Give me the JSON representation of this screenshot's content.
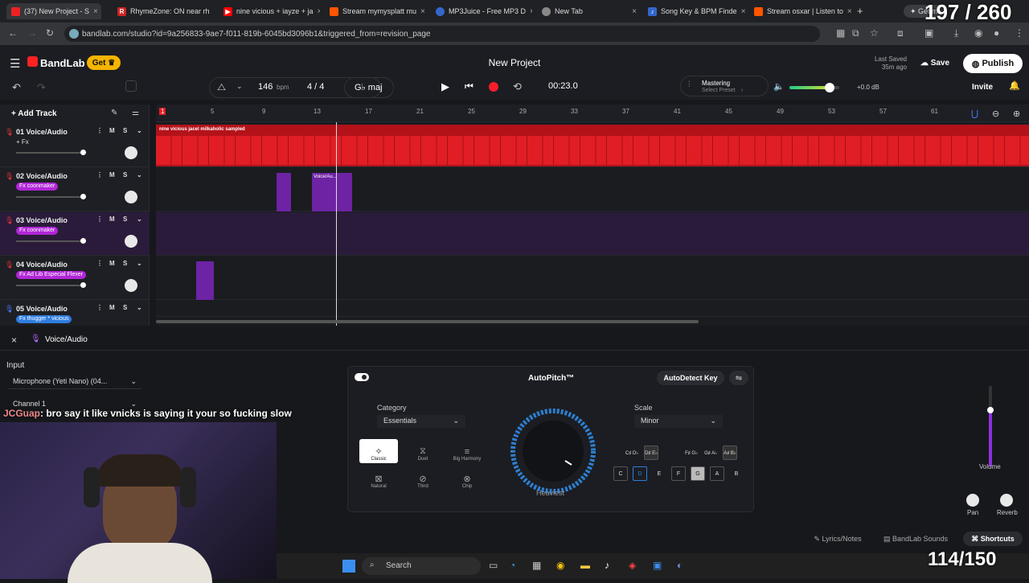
{
  "tabs": [
    {
      "label": "(37) New Project - S",
      "color": "#e22"
    },
    {
      "label": "RhymeZone: ON near rh",
      "color": "#c22"
    },
    {
      "label": "nine vicious + iayze + ja",
      "color": "#f00"
    },
    {
      "label": "Stream mymysplatt mu",
      "color": "#f50"
    },
    {
      "label": "MP3Juice - Free MP3 D",
      "color": "#36c"
    },
    {
      "label": "New Tab",
      "color": "#888"
    },
    {
      "label": "Song Key & BPM Finde",
      "color": "#36c"
    },
    {
      "label": "Stream osxar | Listen to",
      "color": "#f50"
    }
  ],
  "browser": {
    "url": "bandlab.com/studio?id=9a256833-9ae7-f011-819b-6045bd3096b1&triggered_from=revision_page",
    "get_label": "Get m",
    "overlay_count": "197 / 260"
  },
  "app": {
    "logo": "BandLab",
    "get_label": "Get",
    "title": "New Project",
    "last_saved_label": "Last Saved",
    "last_saved_value": "35m ago",
    "save_label": "Save",
    "publish_label": "Publish",
    "invite_label": "Invite"
  },
  "transport": {
    "bpm": "146",
    "bpm_unit": "bpm",
    "time_sig": "4 / 4",
    "key": "G♭ maj",
    "time": "00:23.0",
    "mastering_label": "Mastering",
    "mastering_sub": "Select Preset",
    "volume_db": "+0.0 dB",
    "volume_level": 0.8
  },
  "add_track_label": "Add Track",
  "ruler": [
    "1",
    "5",
    "9",
    "13",
    "17",
    "21",
    "25",
    "29",
    "33",
    "37",
    "41",
    "45",
    "49",
    "53",
    "57",
    "61"
  ],
  "tracks": [
    {
      "name": "01  Voice/Audio",
      "fx": "+ Fx",
      "fx_color": "none"
    },
    {
      "name": "02  Voice/Audio",
      "fx": "Fx  coonmaker",
      "fx_color": "#b026d6"
    },
    {
      "name": "03  Voice/Audio",
      "fx": "Fx  coonmaker",
      "fx_color": "#b026d6"
    },
    {
      "name": "04  Voice/Audio",
      "fx": "Fx  Ad Lib Especial Flexer",
      "fx_color": "#b026d6"
    },
    {
      "name": "05  Voice/Audio",
      "fx": "Fx  thugger * vicious",
      "fx_color": "#2f7de0"
    }
  ],
  "regions": {
    "track1_label": "nine vicious  jacel  milkaholic sampled",
    "track2_label": "Voice/Au..."
  },
  "detail": {
    "close": "×",
    "title": "Voice/Audio",
    "input_label": "Input",
    "input_device": "Microphone (Yeti Nano) (04...",
    "channel": "Channel 1",
    "chat_user": "JCGuap",
    "chat_text": ": bro say it like vnicks is saying it your so fucking slow"
  },
  "autopitch": {
    "title": "AutoPitch™",
    "autodetect": "AutoDetect Key",
    "category_label": "Category",
    "category_value": "Essentials",
    "scale_label": "Scale",
    "scale_value": "Minor",
    "knob_label": "Heaviest",
    "presets": [
      "Classic",
      "Duet",
      "Big Harmony",
      "Natural",
      "Third",
      "Chip"
    ],
    "sharps": [
      "C♯ D♭",
      "D♯ E♭",
      "F♯ G♭",
      "G♯ A♭",
      "A♯ B♭"
    ],
    "naturals": [
      "C",
      "D",
      "E",
      "F",
      "G",
      "A",
      "B"
    ]
  },
  "mixer": {
    "volume": "Volume",
    "pan": "Pan",
    "reverb": "Reverb"
  },
  "footer": {
    "lyrics": "Lyrics/Notes",
    "sounds": "BandLab Sounds",
    "shortcuts": "Shortcuts"
  },
  "taskbar": {
    "search": "Search",
    "overlay_count": "114/150"
  }
}
